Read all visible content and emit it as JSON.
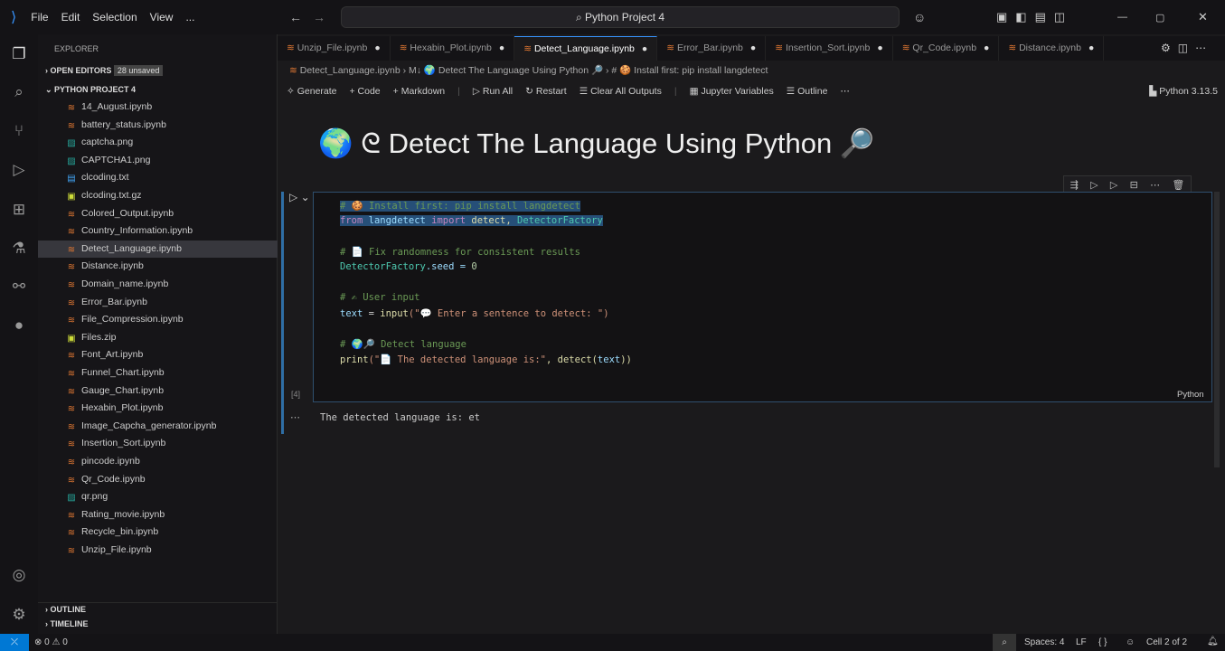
{
  "titlebar": {
    "menus": [
      "File",
      "Edit",
      "Selection",
      "View",
      "..."
    ],
    "search": "Python Project 4"
  },
  "sidebar": {
    "title": "EXPLORER",
    "open_editors": "OPEN EDITORS",
    "unsaved_badge": "28 unsaved",
    "project": "PYTHON PROJECT 4",
    "files": [
      {
        "name": "14_August.ipynb",
        "type": "nb"
      },
      {
        "name": "battery_status.ipynb",
        "type": "nb"
      },
      {
        "name": "captcha.png",
        "type": "img"
      },
      {
        "name": "CAPTCHA1.png",
        "type": "img"
      },
      {
        "name": "clcoding.txt",
        "type": "txt"
      },
      {
        "name": "clcoding.txt.gz",
        "type": "zip"
      },
      {
        "name": "Colored_Output.ipynb",
        "type": "nb"
      },
      {
        "name": "Country_Information.ipynb",
        "type": "nb"
      },
      {
        "name": "Detect_Language.ipynb",
        "type": "nb",
        "selected": true
      },
      {
        "name": "Distance.ipynb",
        "type": "nb"
      },
      {
        "name": "Domain_name.ipynb",
        "type": "nb"
      },
      {
        "name": "Error_Bar.ipynb",
        "type": "nb"
      },
      {
        "name": "File_Compression.ipynb",
        "type": "nb"
      },
      {
        "name": "Files.zip",
        "type": "zip"
      },
      {
        "name": "Font_Art.ipynb",
        "type": "nb"
      },
      {
        "name": "Funnel_Chart.ipynb",
        "type": "nb"
      },
      {
        "name": "Gauge_Chart.ipynb",
        "type": "nb"
      },
      {
        "name": "Hexabin_Plot.ipynb",
        "type": "nb"
      },
      {
        "name": "Image_Capcha_generator.ipynb",
        "type": "nb"
      },
      {
        "name": "Insertion_Sort.ipynb",
        "type": "nb"
      },
      {
        "name": "pincode.ipynb",
        "type": "nb"
      },
      {
        "name": "Qr_Code.ipynb",
        "type": "nb"
      },
      {
        "name": "qr.png",
        "type": "img"
      },
      {
        "name": "Rating_movie.ipynb",
        "type": "nb"
      },
      {
        "name": "Recycle_bin.ipynb",
        "type": "nb"
      },
      {
        "name": "Unzip_File.ipynb",
        "type": "nb"
      }
    ],
    "outline": "OUTLINE",
    "timeline": "TIMELINE"
  },
  "tabs": [
    {
      "label": "Unzip_File.ipynb"
    },
    {
      "label": "Hexabin_Plot.ipynb"
    },
    {
      "label": "Detect_Language.ipynb",
      "active": true
    },
    {
      "label": "Error_Bar.ipynb"
    },
    {
      "label": "Insertion_Sort.ipynb"
    },
    {
      "label": "Qr_Code.ipynb"
    },
    {
      "label": "Distance.ipynb"
    }
  ],
  "breadcrumb": [
    "Detect_Language.ipynb",
    "M↓ 🌍 Detect The Language Using Python 🔎",
    "# 🍪 Install first: pip install langdetect"
  ],
  "toolbar": {
    "generate": "Generate",
    "code": "+ Code",
    "markdown": "+ Markdown",
    "run_all": "Run All",
    "restart": "Restart",
    "clear": "Clear All Outputs",
    "variables": "Jupyter Variables",
    "outline": "Outline",
    "kernel": "Python 3.13.5"
  },
  "heading": "🌍 ᘓ Detect The Language Using Python 🔎",
  "cell": {
    "exec_count": "[4]",
    "language": "Python",
    "lines": {
      "l1": "# 🍪 Install first: pip install langdetect",
      "l2a": "from",
      "l2b": " langdetect ",
      "l2c": "import",
      "l2d": " detect, ",
      "l2e": "DetectorFactory",
      "l3": "# 📄 Fix randomness for consistent results",
      "l4a": "DetectorFactory",
      "l4b": ".seed = ",
      "l4c": "0",
      "l5": "# ✍ User input",
      "l6a": "text",
      "l6b": " = ",
      "l6c": "input",
      "l6d": "(\"💬 Enter a sentence to detect: \")",
      "l7": "# 🌍🔎 Detect language",
      "l8a": "print",
      "l8b": "(\"📄 The detected language is:\"",
      "l8c": ", detect(",
      "l8d": "text",
      "l8e": "))"
    },
    "output": "The detected language is: et"
  },
  "status": {
    "errors": "⊗ 0 ⚠ 0",
    "spaces": "Spaces: 4",
    "eol": "LF",
    "braces": "{ }",
    "cell": "Cell 2 of 2"
  }
}
